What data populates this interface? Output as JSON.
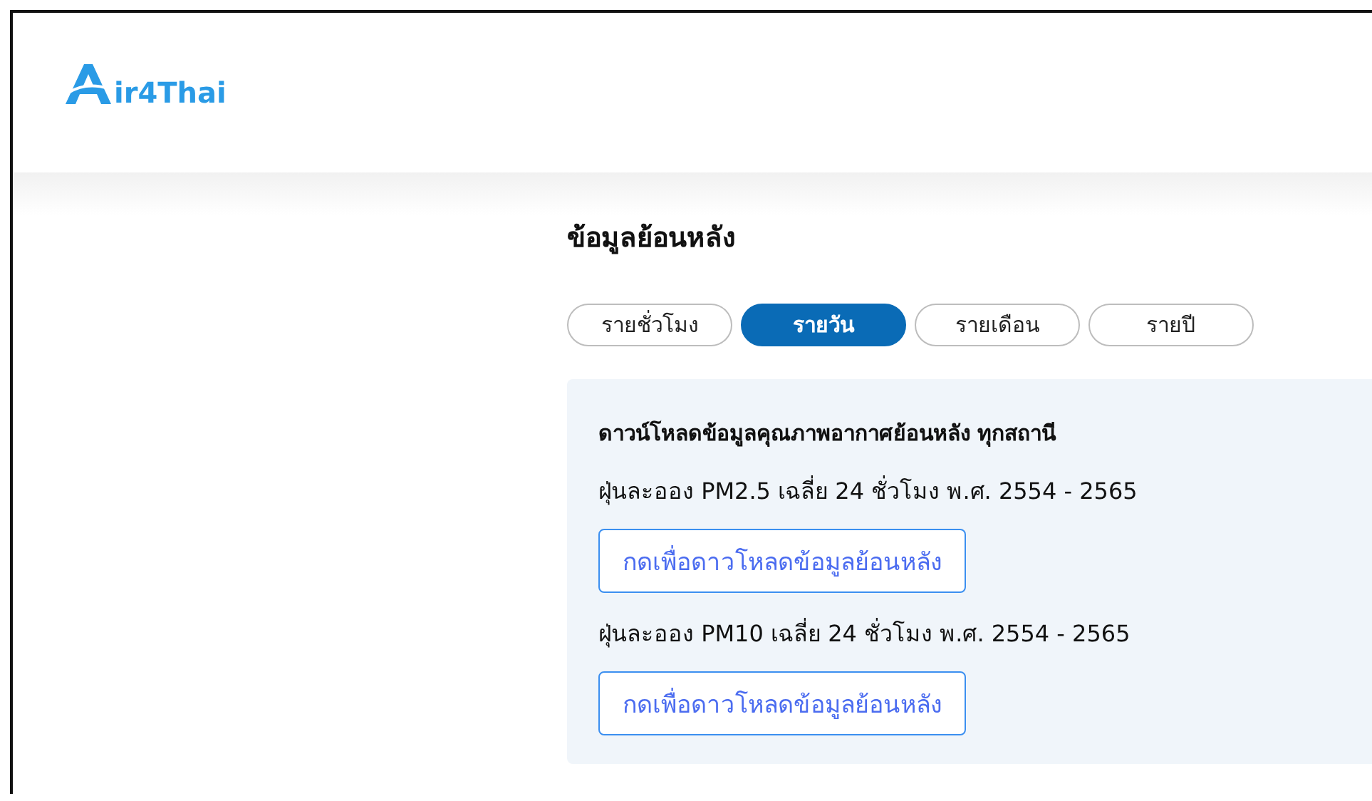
{
  "header": {
    "logo_text": "ir4Thai"
  },
  "section": {
    "title": "ข้อมูลย้อนหลัง"
  },
  "tabs": [
    {
      "label": "รายชั่วโมง",
      "selected": false
    },
    {
      "label": "รายวัน",
      "selected": true
    },
    {
      "label": "รายเดือน",
      "selected": false
    },
    {
      "label": "รายปี",
      "selected": false
    }
  ],
  "panel": {
    "heading": "ดาวน์โหลดข้อมูลคุณภาพอากาศย้อนหลัง ทุกสถานี",
    "downloads": [
      {
        "label": "ฝุ่นละออง PM2.5 เฉลี่ย 24 ชั่วโมง พ.ศ. 2554 - 2565",
        "button": "กดเพื่อดาวโหลดข้อมูลย้อนหลัง"
      },
      {
        "label": "ฝุ่นละออง PM10 เฉลี่ย 24 ชั่วโมง พ.ศ. 2554 - 2565",
        "button": "กดเพื่อดาวโหลดข้อมูลย้อนหลัง"
      }
    ]
  }
}
